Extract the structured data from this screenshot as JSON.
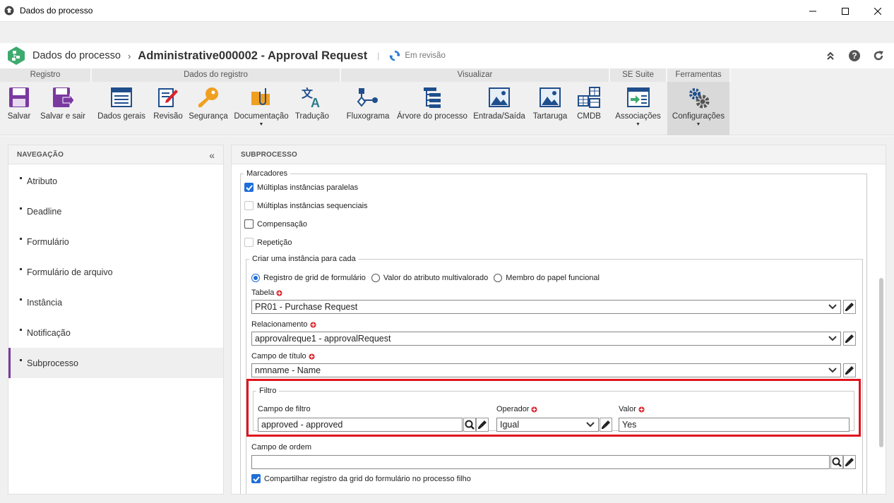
{
  "window": {
    "title": "Dados do processo"
  },
  "header": {
    "breadcrumb_root": "Dados do processo",
    "breadcrumb_sep": "›",
    "record_title": "Administrative000002 - Approval Request",
    "separator": "|",
    "status": "Em revisão"
  },
  "toolbar": {
    "groups": [
      {
        "label": "Registro"
      },
      {
        "label": "Dados do registro"
      },
      {
        "label": "Visualizar"
      },
      {
        "label": "SE Suite"
      },
      {
        "label": "Ferramentas"
      }
    ],
    "buttons": {
      "salvar": "Salvar",
      "salvar_sair": "Salvar e sair",
      "dados_gerais": "Dados gerais",
      "revisao": "Revisão",
      "seguranca": "Segurança",
      "documentacao": "Documentação",
      "traducao": "Tradução",
      "fluxograma": "Fluxograma",
      "arvore": "Árvore do processo",
      "entrada_saida": "Entrada/Saída",
      "tartaruga": "Tartaruga",
      "cmdb": "CMDB",
      "associacoes": "Associações",
      "configuracoes": "Configurações"
    }
  },
  "nav": {
    "title": "NAVEGAÇÃO",
    "items": [
      {
        "label": "Atributo"
      },
      {
        "label": "Deadline"
      },
      {
        "label": "Formulário"
      },
      {
        "label": "Formulário de arquivo"
      },
      {
        "label": "Instância"
      },
      {
        "label": "Notificação"
      },
      {
        "label": "Subprocesso"
      }
    ],
    "active_index": 6
  },
  "content": {
    "title": "SUBPROCESSO",
    "marcadores": {
      "legend": "Marcadores",
      "multi_paralelas": "Múltiplas instâncias paralelas",
      "multi_sequenciais": "Múltiplas instâncias sequenciais",
      "compensacao": "Compensação",
      "repeticao": "Repetição"
    },
    "instancia": {
      "legend": "Criar uma instância para cada",
      "radio_grid": "Registro de grid de formulário",
      "radio_atributo": "Valor do atributo multivalorado",
      "radio_papel": "Membro do papel funcional",
      "tabela_label": "Tabela",
      "tabela_value": "PR01 - Purchase Request",
      "relacionamento_label": "Relacionamento",
      "relacionamento_value": "approvalreque1 - approvalRequest",
      "campo_titulo_label": "Campo de título",
      "campo_titulo_value": "nmname - Name",
      "filtro": {
        "legend": "Filtro",
        "campo_label": "Campo de filtro",
        "campo_value": "approved - approved",
        "operador_label": "Operador",
        "operador_value": "Igual",
        "valor_label": "Valor",
        "valor_value": "Yes"
      },
      "campo_ordem_label": "Campo de ordem",
      "campo_ordem_value": "",
      "compartilhar": "Compartilhar registro da grid do formulário no processo filho"
    }
  },
  "colors": {
    "accent": "#1e6ed8",
    "nav_active": "#7a3aa0",
    "highlight": "#e0141e",
    "required": "#d9232d"
  }
}
